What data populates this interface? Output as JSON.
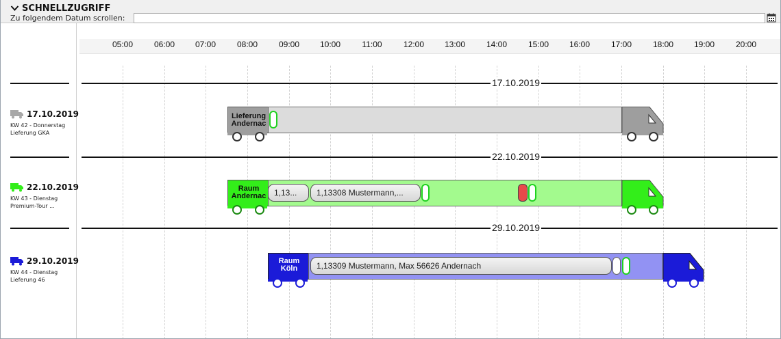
{
  "header": {
    "title": "SCHNELLZUGRIFF",
    "scroll_label": "Zu folgendem Datum scrollen:",
    "scroll_value": ""
  },
  "timeline": {
    "hours": [
      "05:00",
      "06:00",
      "07:00",
      "08:00",
      "09:00",
      "10:00",
      "11:00",
      "12:00",
      "13:00",
      "14:00",
      "15:00",
      "16:00",
      "17:00",
      "18:00",
      "19:00",
      "20:00"
    ]
  },
  "separators": [
    "17.10.2019",
    "22.10.2019",
    "29.10.2019"
  ],
  "rows": [
    {
      "date": "17.10.2019",
      "line1": "KW 42 - Donnerstag",
      "line2": "Lieferung GKA",
      "color": "#9e9e9e",
      "cab_label": "Lieferung Andernac",
      "stops": []
    },
    {
      "date": "22.10.2019",
      "line1": "KW 43 - Dienstag",
      "line2": "Premium-Tour ...",
      "color": "#33ee1a",
      "cab_label": "Raum Andernac",
      "stops": [
        "1,13...",
        "1,13308 Mustermann,..."
      ]
    },
    {
      "date": "29.10.2019",
      "line1": "KW 44 - Dienstag",
      "line2": "Lieferung 46",
      "color": "#1b1bd8",
      "cab_label": "Raum Köln",
      "stops": [
        "1,13309 Mustermann, Max 56626 Andernach"
      ]
    }
  ],
  "colors": {
    "grey_cargo": "#dcdcdc",
    "green_cargo": "#a3fa8e",
    "blue_cargo": "#9292f3",
    "green_marker": "#1fd11f",
    "red_marker": "#e84a4a"
  }
}
